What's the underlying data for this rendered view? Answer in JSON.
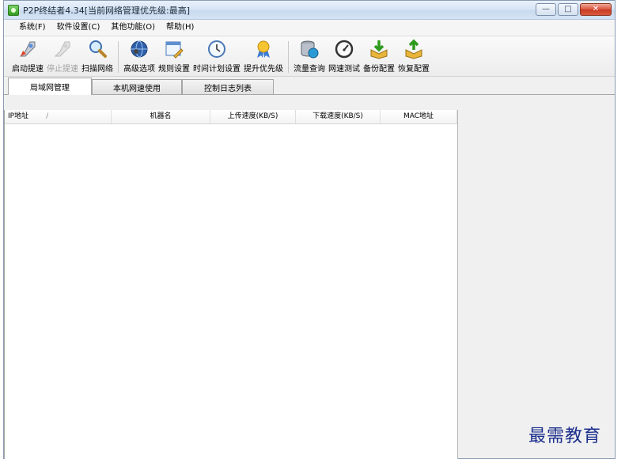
{
  "window": {
    "title": "P2P终结者4.34[当前网络管理优先级:最高]",
    "buttons": {
      "minimize": "—",
      "maximize": "□",
      "close": "✕"
    }
  },
  "menu": [
    "系统(F)",
    "软件设置(C)",
    "其他功能(O)",
    "帮助(H)"
  ],
  "toolbar": {
    "groups": [
      [
        {
          "label": "启动提速",
          "icon": "rocket-icon",
          "enabled": true
        },
        {
          "label": "停止提速",
          "icon": "rocket-stop-icon",
          "enabled": false
        },
        {
          "label": "扫描网络",
          "icon": "magnifier-icon",
          "enabled": true
        }
      ],
      [
        {
          "label": "高级选项",
          "icon": "globe-icon",
          "enabled": true
        },
        {
          "label": "规则设置",
          "icon": "window-pencil-icon",
          "enabled": true
        },
        {
          "label": "时间计划设置",
          "icon": "clock-icon",
          "enabled": true
        },
        {
          "label": "提升优先级",
          "icon": "award-ribbon-icon",
          "enabled": true
        }
      ],
      [
        {
          "label": "流量查询",
          "icon": "database-globe-icon",
          "enabled": true
        },
        {
          "label": "网速测试",
          "icon": "speedometer-icon",
          "enabled": true
        },
        {
          "label": "备份配置",
          "icon": "download-box-icon",
          "enabled": true
        },
        {
          "label": "恢复配置",
          "icon": "restore-box-icon",
          "enabled": true
        }
      ]
    ]
  },
  "tabs": [
    {
      "label": "局域网管理",
      "active": true
    },
    {
      "label": "本机网速使用",
      "active": false
    },
    {
      "label": "控制日志列表",
      "active": false
    }
  ],
  "table": {
    "columns": [
      "IP地址",
      "机器名",
      "上传速度(KB/S)",
      "下载速度(KB/S)",
      "MAC地址"
    ],
    "sort_indicator": "/",
    "rows": []
  },
  "watermark": "最需教育",
  "colors": {
    "accent": "#1b2e8c",
    "close_button": "#d9553f",
    "app_icon": "#2f9a1e"
  }
}
